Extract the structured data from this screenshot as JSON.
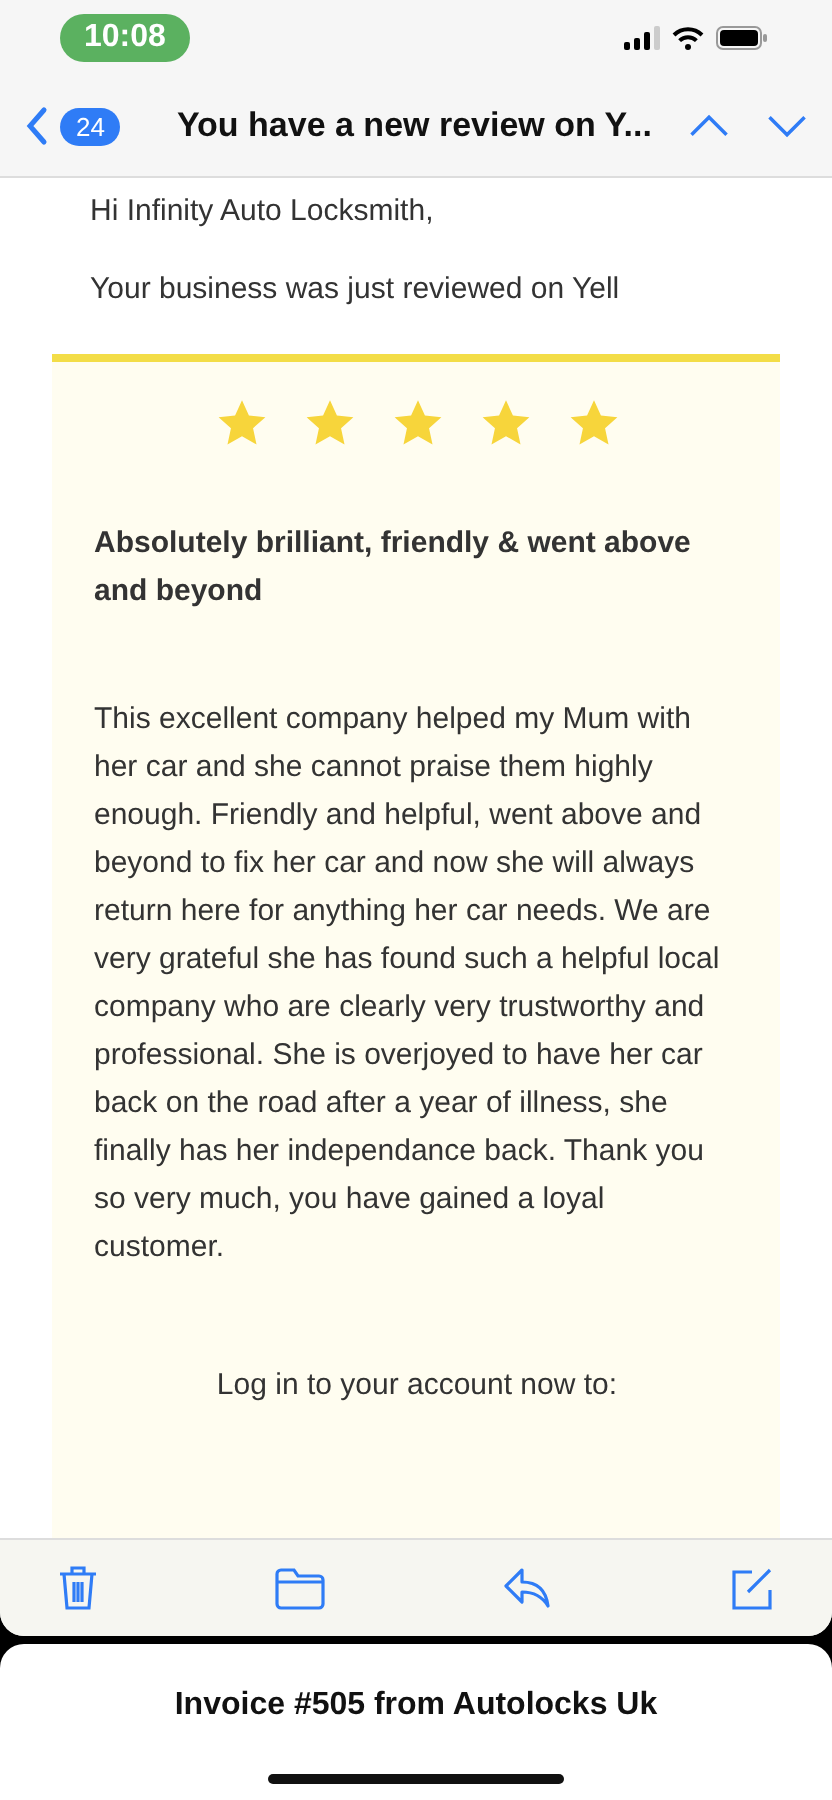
{
  "status_bar": {
    "time": "10:08"
  },
  "nav": {
    "back_count": "24",
    "subject": "You have a new review on Y..."
  },
  "email": {
    "greeting": "Hi Infinity Auto Locksmith,",
    "intro": "Your business was just reviewed on Yell",
    "review": {
      "stars": 5,
      "title": "Absolutely brilliant, friendly & went above and beyond",
      "body": "This excellent company helped my Mum with her car and she cannot praise them highly enough. Friendly and helpful, went above and beyond to fix her car and now she will always return here for anything her car needs. We are very grateful she has found such a helpful local company who are clearly very trustworthy and professional. She is overjoyed to have her car back on the road after a year of illness, she finally has her independance back. Thank you so very much, you have gained a loyal customer."
    },
    "cta": "Log in to your account now to:"
  },
  "draft": {
    "title": "Invoice #505 from Autolocks Uk"
  }
}
